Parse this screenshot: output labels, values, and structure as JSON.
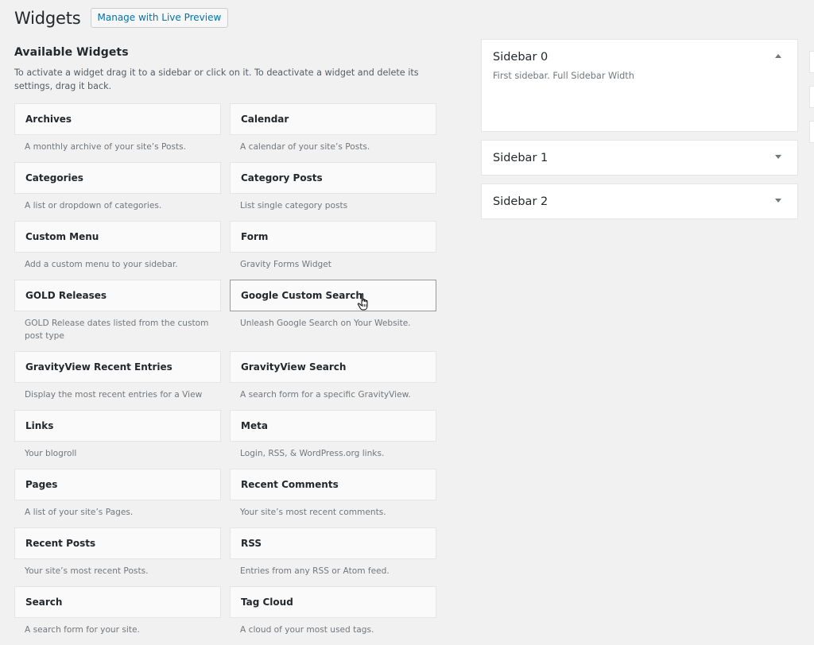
{
  "header": {
    "title": "Widgets",
    "live_preview_label": "Manage with Live Preview"
  },
  "available": {
    "title": "Available Widgets",
    "description": "To activate a widget drag it to a sidebar or click on it. To deactivate a widget and delete its settings, drag it back.",
    "widgets": [
      {
        "title": "Archives",
        "desc": "A monthly archive of your site’s Posts."
      },
      {
        "title": "Calendar",
        "desc": "A calendar of your site’s Posts."
      },
      {
        "title": "Categories",
        "desc": "A list or dropdown of categories."
      },
      {
        "title": "Category Posts",
        "desc": "List single category posts"
      },
      {
        "title": "Custom Menu",
        "desc": "Add a custom menu to your sidebar."
      },
      {
        "title": "Form",
        "desc": "Gravity Forms Widget"
      },
      {
        "title": "GOLD Releases",
        "desc": "GOLD Release dates listed from the custom post type"
      },
      {
        "title": "Google Custom Search",
        "desc": "Unleash Google Search on Your Website."
      },
      {
        "title": "GravityView Recent Entries",
        "desc": "Display the most recent entries for a View"
      },
      {
        "title": "GravityView Search",
        "desc": "A search form for a specific GravityView."
      },
      {
        "title": "Links",
        "desc": "Your blogroll"
      },
      {
        "title": "Meta",
        "desc": "Login, RSS, & WordPress.org links."
      },
      {
        "title": "Pages",
        "desc": "A list of your site’s Pages."
      },
      {
        "title": "Recent Comments",
        "desc": "Your site’s most recent comments."
      },
      {
        "title": "Recent Posts",
        "desc": "Your site’s most recent Posts."
      },
      {
        "title": "RSS",
        "desc": "Entries from any RSS or Atom feed."
      },
      {
        "title": "Search",
        "desc": "A search form for your site."
      },
      {
        "title": "Tag Cloud",
        "desc": "A cloud of your most used tags."
      }
    ]
  },
  "sidebars": [
    {
      "title": "Sidebar 0",
      "description": "First sidebar. Full Sidebar Width",
      "expanded": true
    },
    {
      "title": "Sidebar 1",
      "expanded": false
    },
    {
      "title": "Sidebar 2",
      "expanded": false
    }
  ],
  "colors": {
    "background": "#f1f1f1",
    "link": "#0073aa",
    "text": "#23282d",
    "muted": "#72777c"
  }
}
